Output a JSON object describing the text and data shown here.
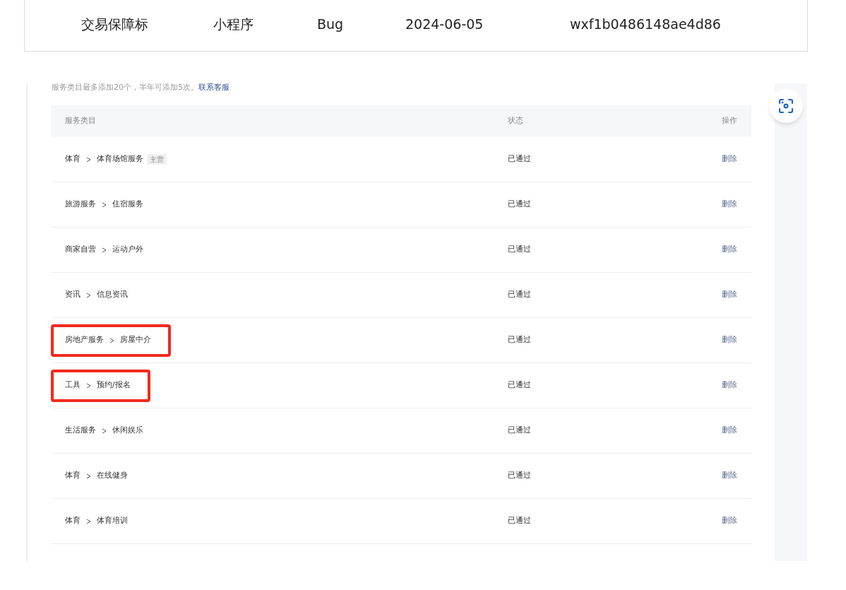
{
  "info_row": [
    "交易保障标",
    "小程序",
    "Bug",
    "2024-06-05",
    "wxf1b0486148ae4d86"
  ],
  "notice": {
    "text": "服务类目最多添加20个，半年可添加5次。",
    "link": "联系客服"
  },
  "table": {
    "columns": [
      "服务类目",
      "状态",
      "操作"
    ],
    "rows": [
      {
        "parent": "体育",
        "child": "体育场馆服务",
        "tag": "主营",
        "status": "已通过",
        "action": "删除",
        "highlighted": false
      },
      {
        "parent": "旅游服务",
        "child": "住宿服务",
        "status": "已通过",
        "action": "删除",
        "highlighted": false
      },
      {
        "parent": "商家自营",
        "child": "运动户外",
        "status": "已通过",
        "action": "删除",
        "highlighted": false
      },
      {
        "parent": "资讯",
        "child": "信息资讯",
        "status": "已通过",
        "action": "删除",
        "highlighted": false
      },
      {
        "parent": "房地产服务",
        "child": "房屋中介",
        "status": "已通过",
        "action": "删除",
        "highlighted": true
      },
      {
        "parent": "工具",
        "child": "预约/报名",
        "status": "已通过",
        "action": "删除",
        "highlighted": true
      },
      {
        "parent": "生活服务",
        "child": "休闲娱乐",
        "status": "已通过",
        "action": "删除",
        "highlighted": false
      },
      {
        "parent": "体育",
        "child": "在线健身",
        "status": "已通过",
        "action": "删除",
        "highlighted": false
      },
      {
        "parent": "体育",
        "child": "体育培训",
        "status": "已通过",
        "action": "删除",
        "highlighted": false
      }
    ]
  }
}
